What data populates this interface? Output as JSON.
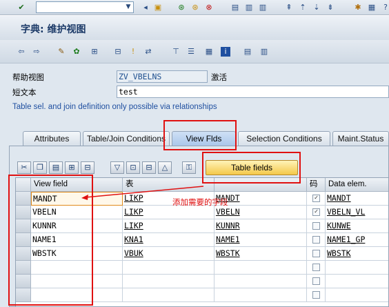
{
  "title": "字典: 维护视图",
  "fields": {
    "help_view_label": "帮助视图",
    "help_view_value": "ZV_VBELNS",
    "status": "激活",
    "short_text_label": "短文本",
    "short_text_value": "test"
  },
  "info_message": "Table sel. and join definition only possible via relationships",
  "tabs": [
    {
      "label": "Attributes"
    },
    {
      "label": "Table/Join Conditions"
    },
    {
      "label": "View Flds"
    },
    {
      "label": "Selection Conditions"
    },
    {
      "label": "Maint.Status"
    }
  ],
  "table_fields_button": "Table fields",
  "annotation": "添加需要的字段",
  "grid": {
    "headers": [
      "View field",
      "表",
      "",
      "码",
      "Data elem."
    ],
    "rows": [
      {
        "view_field": "MANDT",
        "table": "LIKP",
        "field": "MANDT",
        "key": true,
        "data_elem": "MANDT"
      },
      {
        "view_field": "VBELN",
        "table": "LIKP",
        "field": "VBELN",
        "key": true,
        "data_elem": "VBELN_VL"
      },
      {
        "view_field": "KUNNR",
        "table": "LIKP",
        "field": "KUNNR",
        "key": false,
        "data_elem": "KUNWE"
      },
      {
        "view_field": "NAME1",
        "table": "KNA1",
        "field": "NAME1",
        "key": false,
        "data_elem": "NAME1_GP"
      },
      {
        "view_field": "WBSTK",
        "table": "VBUK",
        "field": "WBSTK",
        "key": false,
        "data_elem": "WBSTK"
      },
      {
        "view_field": "",
        "table": "",
        "field": "",
        "key": false,
        "data_elem": ""
      },
      {
        "view_field": "",
        "table": "",
        "field": "",
        "key": false,
        "data_elem": ""
      },
      {
        "view_field": "",
        "table": "",
        "field": "",
        "key": false,
        "data_elem": ""
      }
    ]
  },
  "colors": {
    "accent": "#1f4fa0",
    "annotation": "#e01010",
    "button": "#f4c84a"
  }
}
